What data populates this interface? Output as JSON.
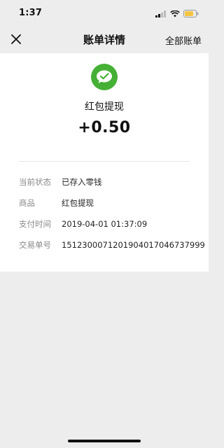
{
  "status_bar": {
    "time": "1:37",
    "icons": [
      "cellular-signal-icon",
      "wifi-icon",
      "battery-icon"
    ],
    "battery_color": "#f5c542"
  },
  "nav": {
    "close_icon": "close-icon",
    "title": "账单详情",
    "action_label": "全部账单"
  },
  "summary": {
    "logo_icon": "wechat-pay-icon",
    "logo_color": "#45b035",
    "merchant": "红包提现",
    "amount": "+0.50"
  },
  "details": [
    {
      "label": "当前状态",
      "value": "已存入零钱"
    },
    {
      "label": "商品",
      "value": "红包提现"
    },
    {
      "label": "支付时间",
      "value": "2019-04-01 01:37:09"
    },
    {
      "label": "交易单号",
      "value": "1512300071201904017046737999"
    }
  ]
}
